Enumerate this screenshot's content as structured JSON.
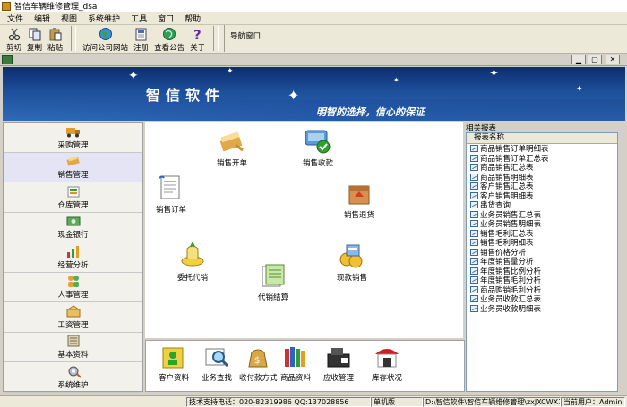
{
  "window": {
    "title": "智信车辆维修管理_dsa"
  },
  "menu": [
    "文件",
    "编辑",
    "视图",
    "系统维护",
    "工具",
    "窗口",
    "帮助"
  ],
  "toolbar": {
    "cut": "剪切",
    "copy": "复制",
    "paste": "粘贴",
    "visit_site": "访问公司网站",
    "register": "注册",
    "view_notice": "查看公告",
    "about": "关于",
    "nav_window": "导航窗口"
  },
  "banner": {
    "brand": "智信软件",
    "slogan": "明智的选择，信心的保证"
  },
  "sidebar": [
    {
      "label": "采购管理",
      "icon": "truck-icon"
    },
    {
      "label": "销售管理",
      "icon": "sales-icon"
    },
    {
      "label": "仓库管理",
      "icon": "warehouse-icon"
    },
    {
      "label": "现金银行",
      "icon": "cash-bank-icon"
    },
    {
      "label": "经营分析",
      "icon": "analysis-icon"
    },
    {
      "label": "人事管理",
      "icon": "personnel-icon"
    },
    {
      "label": "工资管理",
      "icon": "salary-icon"
    },
    {
      "label": "基本资料",
      "icon": "basic-data-icon"
    },
    {
      "label": "系统维护",
      "icon": "system-icon"
    }
  ],
  "flow": {
    "sales_invoice": "销售开单",
    "sales_receipt": "销售收款",
    "sales_order": "销售订单",
    "sales_return": "销售退货",
    "consignment": "委托代销",
    "consignment_settle": "代销结算",
    "cash_sales": "现款销售"
  },
  "bottom": {
    "customer_data": "客户资料",
    "business_search": "业务查找",
    "payment_method": "收付款方式",
    "product_data": "商品资料",
    "receivables": "应收管理",
    "stock_status": "库存状况"
  },
  "reports": {
    "title": "相关报表",
    "header": "报表名称",
    "items": [
      "商品销售订单明细表",
      "商品销售订单汇总表",
      "商品销售汇总表",
      "商品销售明细表",
      "客户销售汇总表",
      "客户销售明细表",
      "串货查询",
      "业务员销售汇总表",
      "业务员销售明细表",
      "销售毛利汇总表",
      "销售毛利明细表",
      "销售价格分析",
      "年度销售量分析",
      "年度销售比例分析",
      "年度销售毛利分析",
      "商品购销毛利分析",
      "业务员收款汇总表",
      "业务员收款明细表"
    ]
  },
  "status": {
    "support": "技术支持电话：020-82319986 QQ:137028856",
    "edition": "单机版",
    "path": "D:\\智信软件\\智信车辆维修管理\\zxJXCWX1.sys",
    "user": "当前用户：Admin"
  },
  "colors": {
    "banner_dark": "#0d2d6e",
    "banner_light": "#2f6bb8",
    "chrome": "#ece9d8"
  }
}
